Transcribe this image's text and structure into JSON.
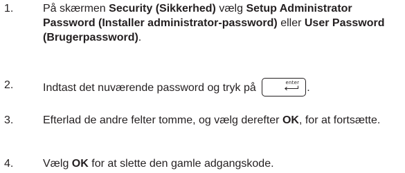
{
  "steps": [
    {
      "num": "1.",
      "parts": [
        {
          "t": "På skærmen ",
          "b": false
        },
        {
          "t": "Security (Sikkerhed)",
          "b": true
        },
        {
          "t": " vælg ",
          "b": false
        },
        {
          "t": "Setup Administrator Password (Installer administrator-password)",
          "b": true
        },
        {
          "t": " eller ",
          "b": false
        },
        {
          "t": "User Password (Brugerpassword)",
          "b": true
        },
        {
          "t": ".",
          "b": false
        }
      ]
    },
    {
      "num": "2.",
      "parts": [
        {
          "t": "Indtast det nuværende password og tryk på ",
          "b": false
        },
        {
          "key": "enter"
        },
        {
          "t": ".",
          "b": false
        }
      ]
    },
    {
      "num": "3.",
      "parts": [
        {
          "t": "Efterlad de andre felter tomme, og vælg derefter ",
          "b": false
        },
        {
          "t": "OK",
          "b": true
        },
        {
          "t": ", for at fortsætte.",
          "b": false
        }
      ]
    },
    {
      "num": "4.",
      "parts": [
        {
          "t": "Vælg ",
          "b": false
        },
        {
          "t": "OK",
          "b": true
        },
        {
          "t": " for at slette den gamle adgangskode.",
          "b": false
        }
      ]
    }
  ],
  "enter_key": {
    "label": "enter",
    "icon": "return-arrow-icon"
  }
}
